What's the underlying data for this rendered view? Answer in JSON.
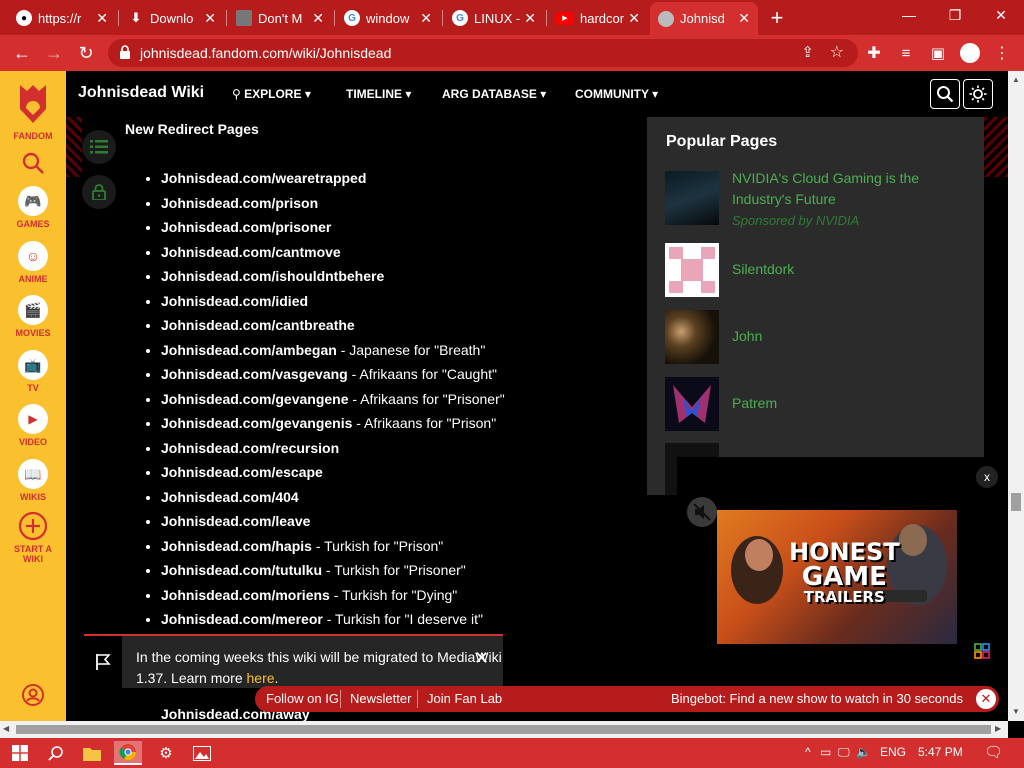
{
  "browser": {
    "tabs": [
      {
        "title": "https://r",
        "icon": "github-icon"
      },
      {
        "title": "Downlo",
        "icon": "download-icon"
      },
      {
        "title": "Don't M",
        "icon": "roblox-icon"
      },
      {
        "title": "window",
        "icon": "google-icon"
      },
      {
        "title": "LINUX -",
        "icon": "google-icon"
      },
      {
        "title": "hardcor",
        "icon": "youtube-icon"
      },
      {
        "title": "Johnisd",
        "icon": "fandom-favicon-icon",
        "active": true
      }
    ],
    "new_tab": "+",
    "url": "johnisdead.fandom.com/wiki/Johnisdead"
  },
  "rail": {
    "brand": "FANDOM",
    "items": [
      "GAMES",
      "ANIME",
      "MOVIES",
      "TV",
      "VIDEO",
      "WIKIS"
    ],
    "start_wiki": [
      "START A",
      "WIKI"
    ]
  },
  "wiki": {
    "name": "Johnisdead Wiki",
    "nav": [
      "EXPLORE",
      "TIMELINE",
      "ARG DATABASE",
      "COMMUNITY"
    ]
  },
  "content": {
    "section_title": "New Redirect Pages",
    "items": [
      {
        "link": "Johnisdead.com/wearetrapped",
        "note": ""
      },
      {
        "link": "Johnisdead.com/prison",
        "note": ""
      },
      {
        "link": "Johnisdead.com/prisoner",
        "note": ""
      },
      {
        "link": "Johnisdead.com/cantmove",
        "note": ""
      },
      {
        "link": "Johnisdead.com/ishouldntbehere",
        "note": ""
      },
      {
        "link": "Johnisdead.com/idied",
        "note": ""
      },
      {
        "link": "Johnisdead.com/cantbreathe",
        "note": ""
      },
      {
        "link": "Johnisdead.com/ambegan",
        "note": " - Japanese for \"Breath\""
      },
      {
        "link": "Johnisdead.com/vasgevang",
        "note": " - Afrikaans for \"Caught\""
      },
      {
        "link": "Johnisdead.com/gevangene",
        "note": " - Afrikaans for \"Prisoner\""
      },
      {
        "link": "Johnisdead.com/gevangenis",
        "note": " - Afrikaans for \"Prison\""
      },
      {
        "link": "Johnisdead.com/recursion",
        "note": ""
      },
      {
        "link": "Johnisdead.com/escape",
        "note": ""
      },
      {
        "link": "Johnisdead.com/404",
        "note": ""
      },
      {
        "link": "Johnisdead.com/leave",
        "note": ""
      },
      {
        "link": "Johnisdead.com/hapis",
        "note": " - Turkish for \"Prison\""
      },
      {
        "link": "Johnisdead.com/tutulku",
        "note": " - Turkish for \"Prisoner\""
      },
      {
        "link": "Johnisdead.com/moriens",
        "note": " - Turkish for \"Dying\""
      },
      {
        "link": "Johnisdead.com/mereor",
        "note": " - Turkish for \"I deserve it\""
      }
    ],
    "last_item": "Johnisdead.com/away"
  },
  "popular": {
    "title": "Popular Pages",
    "items": [
      {
        "label": "NVIDIA's Cloud Gaming is the Industry's Future",
        "sponsor": "Sponsored by NVIDIA"
      },
      {
        "label": "Silentdork"
      },
      {
        "label": "John"
      },
      {
        "label": "Patrem"
      }
    ]
  },
  "ad": {
    "close": "x",
    "video_text": [
      "HONEST",
      "GAME",
      "TRAILERS"
    ]
  },
  "notice": {
    "text_before": "In the coming weeks this wiki will be migrated to MediaWiki 1.37. Learn more ",
    "link": "here",
    "text_after": "."
  },
  "bar": {
    "items": [
      "Follow on IG",
      "Newsletter",
      "Join Fan Lab"
    ],
    "bingebot": "Bingebot: Find a new show to watch in 30 seconds"
  },
  "taskbar": {
    "lang": "ENG",
    "time": "5:47 PM"
  }
}
